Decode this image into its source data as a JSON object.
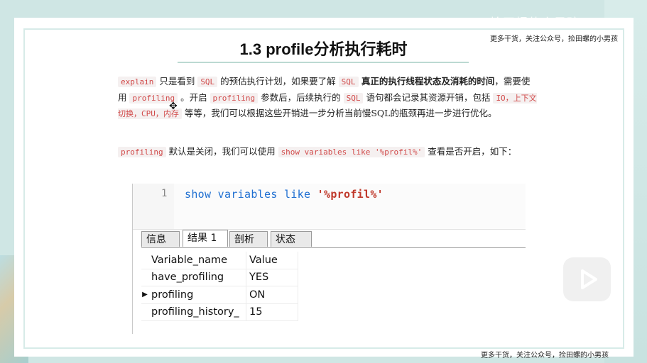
{
  "watermark": {
    "top_text": "捡田螺的小男孩"
  },
  "header_note": "更多干货，关注公众号，捡田螺的小男孩",
  "footer_note": "更多干货，关注公众号，捡田螺的小男孩",
  "title": "1.3 profile分析执行耗时",
  "paragraph1": {
    "t1": "explain",
    "t2": " 只是看到 ",
    "t3": "SQL",
    "t4": " 的预估执行计划，如果要了解 ",
    "t5": "SQL",
    "t6": " 真正的执行线程状态及消耗的时间",
    "t7": "，需要使用 ",
    "t8": "profiling",
    "t9": " 。开启 ",
    "t10": "profiling",
    "t11": " 参数后，后续执行的 ",
    "t12": "SQL",
    "t13": " 语句都会记录其资源开销，包括 ",
    "t14": "IO，上下文切换，CPU，内存",
    "t15": " 等等，我们可以根据这些开销进一步分析当前慢SQL的瓶颈再进一步进行优化。"
  },
  "paragraph2": {
    "t1": "profiling",
    "t2": " 默认是关闭，我们可以使用 ",
    "t3": "show variables like '%profil%'",
    "t4": " 查看是否开启，如下："
  },
  "editor": {
    "line_number": "1",
    "kw1": "show",
    "kw2": "variables",
    "kw3": "like",
    "str": "'%profil%'"
  },
  "tabs": [
    "信息",
    "结果 1",
    "剖析",
    "状态"
  ],
  "result_table": {
    "headers": [
      "Variable_name",
      "Value"
    ],
    "rows": [
      [
        "have_profiling",
        "YES"
      ],
      [
        "profiling",
        "ON"
      ],
      [
        "profiling_history_",
        "15"
      ]
    ],
    "current_row_marker": "▶"
  }
}
